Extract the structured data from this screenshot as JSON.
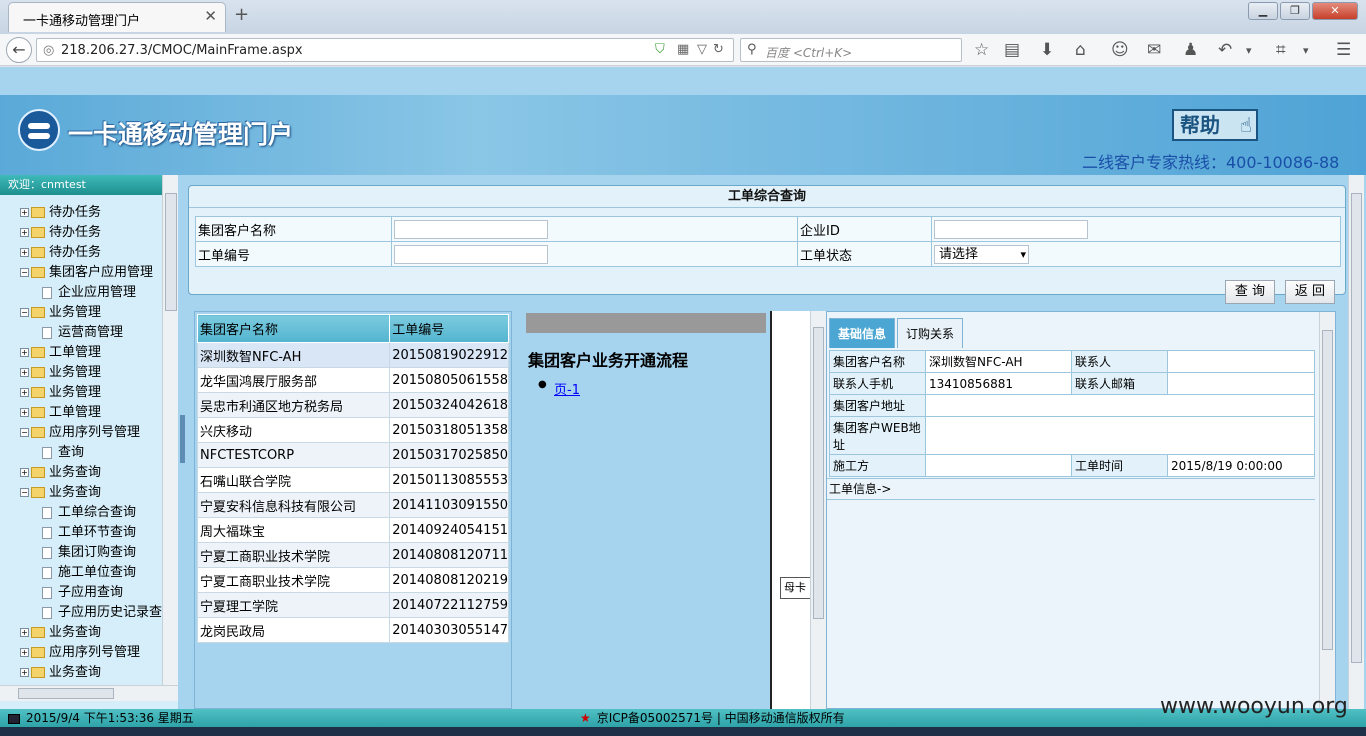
{
  "browser": {
    "tab_title": "一卡通移动管理门户",
    "new_tab": "+",
    "url": "218.206.27.3/CMOC/MainFrame.aspx",
    "search_placeholder": "百度 <Ctrl+K>"
  },
  "header": {
    "portal_title": "一卡通移动管理门户",
    "help_label": "帮助",
    "hotline": "二线客户专家热线：400-10086-88"
  },
  "sidebar": {
    "welcome": "欢迎：cnmtest",
    "items": [
      {
        "label": "待办任务",
        "type": "folder",
        "level": 0,
        "expanded": false
      },
      {
        "label": "待办任务",
        "type": "folder",
        "level": 0,
        "expanded": false
      },
      {
        "label": "待办任务",
        "type": "folder",
        "level": 0,
        "expanded": false
      },
      {
        "label": "集团客户应用管理",
        "type": "folder",
        "level": 0,
        "expanded": true
      },
      {
        "label": "企业应用管理",
        "type": "doc",
        "level": 1
      },
      {
        "label": "业务管理",
        "type": "folder",
        "level": 0,
        "expanded": true
      },
      {
        "label": "运营商管理",
        "type": "doc",
        "level": 1
      },
      {
        "label": "工单管理",
        "type": "folder",
        "level": 0,
        "expanded": false
      },
      {
        "label": "业务管理",
        "type": "folder",
        "level": 0,
        "expanded": false
      },
      {
        "label": "业务管理",
        "type": "folder",
        "level": 0,
        "expanded": false
      },
      {
        "label": "工单管理",
        "type": "folder",
        "level": 0,
        "expanded": false
      },
      {
        "label": "应用序列号管理",
        "type": "folder",
        "level": 0,
        "expanded": true
      },
      {
        "label": "查询",
        "type": "doc",
        "level": 1
      },
      {
        "label": "业务查询",
        "type": "folder",
        "level": 0,
        "expanded": false
      },
      {
        "label": "业务查询",
        "type": "folder",
        "level": 0,
        "expanded": true
      },
      {
        "label": "工单综合查询",
        "type": "doc",
        "level": 1
      },
      {
        "label": "工单环节查询",
        "type": "doc",
        "level": 1
      },
      {
        "label": "集团订购查询",
        "type": "doc",
        "level": 1
      },
      {
        "label": "施工单位查询",
        "type": "doc",
        "level": 1
      },
      {
        "label": "子应用查询",
        "type": "doc",
        "level": 1
      },
      {
        "label": "子应用历史记录查",
        "type": "doc",
        "level": 1
      },
      {
        "label": "业务查询",
        "type": "folder",
        "level": 0,
        "expanded": false
      },
      {
        "label": "应用序列号管理",
        "type": "folder",
        "level": 0,
        "expanded": false
      },
      {
        "label": "业务查询",
        "type": "folder",
        "level": 0,
        "expanded": false
      }
    ]
  },
  "query": {
    "title": "工单综合查询",
    "customer_name_label": "集团客户名称",
    "enterprise_id_label": "企业ID",
    "order_no_label": "工单编号",
    "status_label": "工单状态",
    "status_value": "请选择",
    "search_button": "查 询",
    "back_button": "返 回"
  },
  "orders": {
    "headers": [
      "集团客户名称",
      "工单编号"
    ],
    "rows": [
      [
        "深圳数智NFC-AH",
        "20150819022912"
      ],
      [
        "龙华国鸿展厅服务部",
        "20150805061558"
      ],
      [
        "吴忠市利通区地方税务局",
        "20150324042618"
      ],
      [
        "兴庆移动",
        "20150318051358"
      ],
      [
        "NFCTESTCORP",
        "20150317025850"
      ],
      [
        "石嘴山联合学院",
        "20150113085553"
      ],
      [
        "宁夏安科信息科技有限公司",
        "20141103091550"
      ],
      [
        "周大福珠宝",
        "20140924054151"
      ],
      [
        "宁夏工商职业技术学院",
        "20140808120711"
      ],
      [
        "宁夏工商职业技术学院",
        "20140808120219"
      ],
      [
        "宁夏理工学院",
        "20140722112759"
      ],
      [
        "龙岗民政局",
        "20140303055147"
      ]
    ]
  },
  "flow": {
    "title": "集团客户业务开通流程",
    "item": "页-1",
    "frame_label": "母卡"
  },
  "detail": {
    "tab_basic": "基础信息",
    "tab_order": "订购关系",
    "customer_name_label": "集团客户名称",
    "customer_name_value": "深圳数智NFC-AH",
    "contact_label": "联系人",
    "contact_value": "",
    "phone_label": "联系人手机",
    "phone_value": "13410856881",
    "email_label": "联系人邮箱",
    "email_value": "",
    "address_label": "集团客户地址",
    "address_value": "",
    "web_label": "集团客户WEB地址",
    "web_value": "",
    "builder_label": "施工方",
    "builder_value": "",
    "time_label": "工单时间",
    "time_value": "2015/8/19 0:00:00",
    "order_info": "工单信息->"
  },
  "statusbar": {
    "datetime": "2015/9/4 下午1:53:36 星期五",
    "icp": "京ICP备05002571号 | 中国移动通信版权所有"
  },
  "watermark": "www.wooyun.org"
}
